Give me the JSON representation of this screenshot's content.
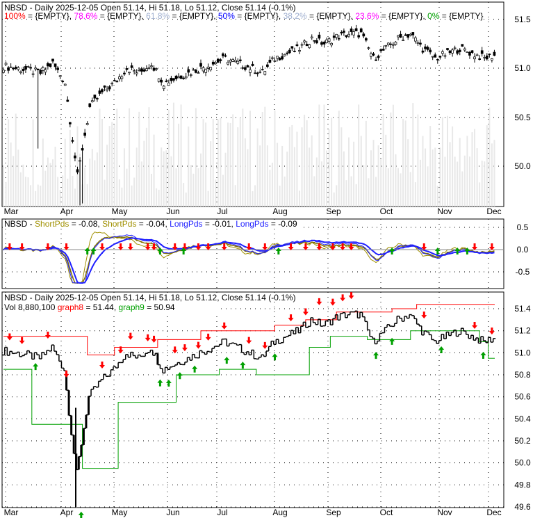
{
  "chart_data": [
    {
      "type": "candlestick",
      "title": "NBSD - Daily 2025-12-05 Open 51.14, Hi 51.18, Lo 51.12, Close 51.14 (-0.1%)",
      "fib_legend": [
        {
          "label": "100%",
          "value": "{EMPTY}",
          "color": "#ff0000"
        },
        {
          "label": "78.6%",
          "value": "{EMPTY}",
          "color": "#ff00ff"
        },
        {
          "label": "61.8%",
          "value": "{EMPTY}",
          "color": "#a0b0d0"
        },
        {
          "label": "50%",
          "value": "{EMPTY}",
          "color": "#0000ff"
        },
        {
          "label": "38.2%",
          "value": "{EMPTY}",
          "color": "#a0b0d0"
        },
        {
          "label": "23.6%",
          "value": "{EMPTY}",
          "color": "#ff00ff"
        },
        {
          "label": "0%",
          "value": "{EMPTY}",
          "color": "#00a000"
        }
      ],
      "yticks": [
        "51.5",
        "51.0",
        "50.5",
        "50.0"
      ],
      "ylim": [
        49.59,
        51.68
      ],
      "xticks": [
        "Mar",
        "Apr",
        "May",
        "Jun",
        "Jul",
        "Aug",
        "Sep",
        "Oct",
        "Nov",
        "Dec"
      ],
      "weekly_close": [
        51.02,
        51.0,
        50.98,
        50.95,
        51.05,
        50.85,
        49.9,
        50.6,
        50.75,
        50.85,
        51.0,
        50.95,
        51.05,
        50.85,
        50.9,
        50.95,
        51.0,
        51.05,
        51.1,
        51.05,
        51.0,
        50.95,
        51.1,
        51.15,
        51.2,
        51.3,
        51.25,
        51.32,
        51.35,
        51.35,
        51.1,
        51.2,
        51.3,
        51.35,
        51.2,
        51.1,
        51.15,
        51.2,
        51.15,
        51.1,
        51.14
      ]
    },
    {
      "type": "line",
      "title_prefix": "NBSD -",
      "legend": [
        {
          "label": "ShortPds",
          "value": "-0.08",
          "color": "#a09000"
        },
        {
          "label": "ShortPds",
          "value": "-0.04",
          "color": "#a09000"
        },
        {
          "label": "LongPds",
          "value": "-0.01",
          "color": "#2020ff"
        },
        {
          "label": "LongPds",
          "value": "-0.09",
          "color": "#2020ff"
        }
      ],
      "yticks": [
        "0.5",
        "0.0",
        "-0.5"
      ],
      "ylim": [
        -0.85,
        0.6
      ]
    },
    {
      "type": "bar",
      "title": "NBSD - Daily 2025-12-05 Open 51.14, Hi 51.18, Lo 51.12, Close 51.14 (-0.1%)",
      "vol_label": "Vol 8,880,100",
      "legend": [
        {
          "label": "graph8",
          "value": "51.44",
          "color": "#ff0000"
        },
        {
          "label": "graph9",
          "value": "50.94",
          "color": "#00a000"
        }
      ],
      "yticks": [
        "51.4",
        "51.2",
        "51.0",
        "50.8",
        "50.6",
        "50.4",
        "50.2",
        "50.0",
        "49.8",
        "49.6"
      ],
      "ylim": [
        49.6,
        51.5
      ],
      "xticks": [
        "Mar",
        "Apr",
        "May",
        "Jun",
        "Jul",
        "Aug",
        "Sep",
        "Oct",
        "Nov",
        "Dec"
      ],
      "graph8_steps": [
        [
          0,
          51.15
        ],
        [
          6.8,
          50.98
        ],
        [
          9,
          51.05
        ],
        [
          12.5,
          51.12
        ],
        [
          16,
          51.2
        ],
        [
          19.5,
          51.2
        ],
        [
          22,
          51.25
        ],
        [
          24.5,
          51.3
        ],
        [
          27,
          51.37
        ],
        [
          31.5,
          51.4
        ],
        [
          33.5,
          51.44
        ]
      ],
      "graph9_steps": [
        [
          0,
          50.85
        ],
        [
          2.3,
          50.35
        ],
        [
          6.4,
          49.95
        ],
        [
          9.3,
          50.55
        ],
        [
          14,
          50.8
        ],
        [
          17.5,
          50.85
        ],
        [
          20.5,
          50.8
        ],
        [
          24.8,
          51.05
        ],
        [
          26.5,
          51.15
        ],
        [
          29.5,
          51.12
        ],
        [
          33,
          51.2
        ],
        [
          38.6,
          51.1
        ],
        [
          39.3,
          50.95
        ]
      ],
      "down_arrows": [
        0.5,
        1.5,
        3.6,
        5.1,
        8.0,
        9.5,
        10.3,
        11.7,
        12.2,
        13.9,
        14.7,
        15.8,
        16.6,
        17.9,
        19.9,
        21.2,
        23.3,
        24.5,
        25.6,
        26.7,
        27.5,
        28.2,
        34.1,
        38.2,
        39.6
      ],
      "up_arrows": [
        2.6,
        6.3,
        12.7,
        13.4,
        14.3,
        15.5,
        18.1,
        19.4,
        22.0,
        30.2,
        31.5,
        35.5,
        38.9
      ]
    }
  ]
}
